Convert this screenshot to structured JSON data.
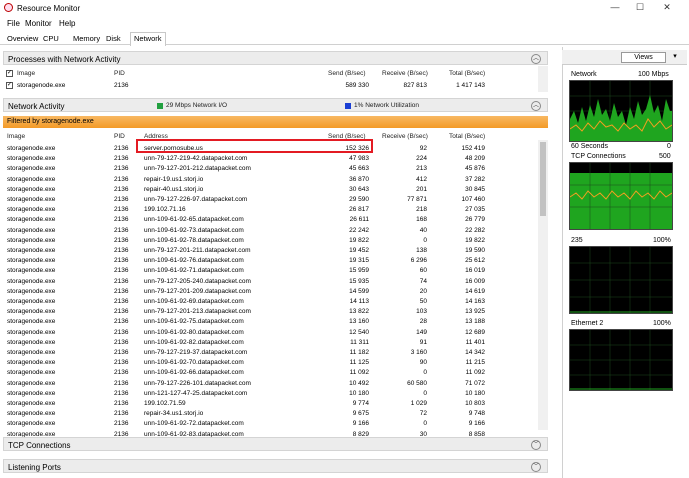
{
  "window": {
    "title": "Resource Monitor",
    "minimize": "—",
    "maximize": "☐",
    "close": "✕"
  },
  "menu": [
    "File",
    "Monitor",
    "Help"
  ],
  "tabs": [
    "Overview",
    "CPU",
    "Memory",
    "Disk",
    "Network"
  ],
  "processes": {
    "header": "Processes with Network Activity",
    "columns": {
      "image": "Image",
      "pid": "PID",
      "send": "Send (B/sec)",
      "receive": "Receive (B/sec)",
      "total": "Total (B/sec)"
    },
    "rows": [
      {
        "image": "storagenode.exe",
        "pid": "2136",
        "send": "589 330",
        "receive": "827 813",
        "total": "1 417 143"
      }
    ]
  },
  "network_activity": {
    "header": "Network Activity",
    "legend1": "29 Mbps Network I/O",
    "legend2": "1% Network Utilization",
    "legend1_color": "#22a040",
    "legend2_color": "#1a3fd4",
    "filter": "Filtered by storagenode.exe",
    "columns": {
      "image": "Image",
      "pid": "PID",
      "address": "Address",
      "send": "Send (B/sec)",
      "receive": "Receive (B/sec)",
      "total": "Total (B/sec)"
    },
    "rows": [
      {
        "image": "storagenode.exe",
        "pid": "2136",
        "address": "server.pornosube.us",
        "send": "152 326",
        "receive": "92",
        "total": "152 419"
      },
      {
        "image": "storagenode.exe",
        "pid": "2136",
        "address": "unn-79-127-219-42.datapacket.com",
        "send": "47 983",
        "receive": "224",
        "total": "48 209"
      },
      {
        "image": "storagenode.exe",
        "pid": "2136",
        "address": "unn-79-127-201-212.datapacket.com",
        "send": "45 663",
        "receive": "213",
        "total": "45 876"
      },
      {
        "image": "storagenode.exe",
        "pid": "2136",
        "address": "repair-19.us1.storj.io",
        "send": "36 870",
        "receive": "412",
        "total": "37 282"
      },
      {
        "image": "storagenode.exe",
        "pid": "2136",
        "address": "repair-40.us1.storj.io",
        "send": "30 643",
        "receive": "201",
        "total": "30 845"
      },
      {
        "image": "storagenode.exe",
        "pid": "2136",
        "address": "unn-79-127-226-97.datapacket.com",
        "send": "29 590",
        "receive": "77 871",
        "total": "107 460"
      },
      {
        "image": "storagenode.exe",
        "pid": "2136",
        "address": "199.102.71.16",
        "send": "26 817",
        "receive": "218",
        "total": "27 035"
      },
      {
        "image": "storagenode.exe",
        "pid": "2136",
        "address": "unn-109-61-92-65.datapacket.com",
        "send": "26 611",
        "receive": "168",
        "total": "26 779"
      },
      {
        "image": "storagenode.exe",
        "pid": "2136",
        "address": "unn-109-61-92-73.datapacket.com",
        "send": "22 242",
        "receive": "40",
        "total": "22 282"
      },
      {
        "image": "storagenode.exe",
        "pid": "2136",
        "address": "unn-109-61-92-78.datapacket.com",
        "send": "19 822",
        "receive": "0",
        "total": "19 822"
      },
      {
        "image": "storagenode.exe",
        "pid": "2136",
        "address": "unn-79-127-201-211.datapacket.com",
        "send": "19 452",
        "receive": "138",
        "total": "19 590"
      },
      {
        "image": "storagenode.exe",
        "pid": "2136",
        "address": "unn-109-61-92-76.datapacket.com",
        "send": "19 315",
        "receive": "6 296",
        "total": "25 612"
      },
      {
        "image": "storagenode.exe",
        "pid": "2136",
        "address": "unn-109-61-92-71.datapacket.com",
        "send": "15 959",
        "receive": "60",
        "total": "16 019"
      },
      {
        "image": "storagenode.exe",
        "pid": "2136",
        "address": "unn-79-127-205-240.datapacket.com",
        "send": "15 935",
        "receive": "74",
        "total": "16 009"
      },
      {
        "image": "storagenode.exe",
        "pid": "2136",
        "address": "unn-79-127-201-209.datapacket.com",
        "send": "14 599",
        "receive": "20",
        "total": "14 619"
      },
      {
        "image": "storagenode.exe",
        "pid": "2136",
        "address": "unn-109-61-92-69.datapacket.com",
        "send": "14 113",
        "receive": "50",
        "total": "14 163"
      },
      {
        "image": "storagenode.exe",
        "pid": "2136",
        "address": "unn-79-127-201-213.datapacket.com",
        "send": "13 822",
        "receive": "103",
        "total": "13 925"
      },
      {
        "image": "storagenode.exe",
        "pid": "2136",
        "address": "unn-109-61-92-75.datapacket.com",
        "send": "13 160",
        "receive": "28",
        "total": "13 188"
      },
      {
        "image": "storagenode.exe",
        "pid": "2136",
        "address": "unn-109-61-92-80.datapacket.com",
        "send": "12 540",
        "receive": "149",
        "total": "12 689"
      },
      {
        "image": "storagenode.exe",
        "pid": "2136",
        "address": "unn-109-61-92-82.datapacket.com",
        "send": "11 311",
        "receive": "91",
        "total": "11 401"
      },
      {
        "image": "storagenode.exe",
        "pid": "2136",
        "address": "unn-79-127-219-37.datapacket.com",
        "send": "11 182",
        "receive": "3 160",
        "total": "14 342"
      },
      {
        "image": "storagenode.exe",
        "pid": "2136",
        "address": "unn-109-61-92-70.datapacket.com",
        "send": "11 125",
        "receive": "90",
        "total": "11 215"
      },
      {
        "image": "storagenode.exe",
        "pid": "2136",
        "address": "unn-109-61-92-66.datapacket.com",
        "send": "11 092",
        "receive": "0",
        "total": "11 092"
      },
      {
        "image": "storagenode.exe",
        "pid": "2136",
        "address": "unn-79-127-226-101.datapacket.com",
        "send": "10 492",
        "receive": "60 580",
        "total": "71 072"
      },
      {
        "image": "storagenode.exe",
        "pid": "2136",
        "address": "unn-121-127-47-25.datapacket.com",
        "send": "10 180",
        "receive": "0",
        "total": "10 180"
      },
      {
        "image": "storagenode.exe",
        "pid": "2136",
        "address": "199.102.71.59",
        "send": "9 774",
        "receive": "1 029",
        "total": "10 803"
      },
      {
        "image": "storagenode.exe",
        "pid": "2136",
        "address": "repair-34.us1.storj.io",
        "send": "9 675",
        "receive": "72",
        "total": "9 748"
      },
      {
        "image": "storagenode.exe",
        "pid": "2136",
        "address": "unn-109-61-92-72.datapacket.com",
        "send": "9 166",
        "receive": "0",
        "total": "9 166"
      },
      {
        "image": "storagenode.exe",
        "pid": "2136",
        "address": "unn-109-61-92-83.datapacket.com",
        "send": "8 829",
        "receive": "30",
        "total": "8 858"
      }
    ]
  },
  "tcp": {
    "header": "TCP Connections"
  },
  "listening": {
    "header": "Listening Ports"
  },
  "right_panel": {
    "views": "Views",
    "graphs": [
      {
        "title": "Network",
        "right": "100 Mbps",
        "bottom_left": "60 Seconds",
        "bottom_right": "0"
      },
      {
        "title": "TCP Connections",
        "right": "500",
        "bottom_left": "",
        "bottom_right": ""
      },
      {
        "title": "235",
        "right": "100%",
        "bottom_left": "",
        "bottom_right": ""
      },
      {
        "title": "Ethernet 2",
        "right": "100%",
        "bottom_left": "",
        "bottom_right": ""
      }
    ]
  }
}
